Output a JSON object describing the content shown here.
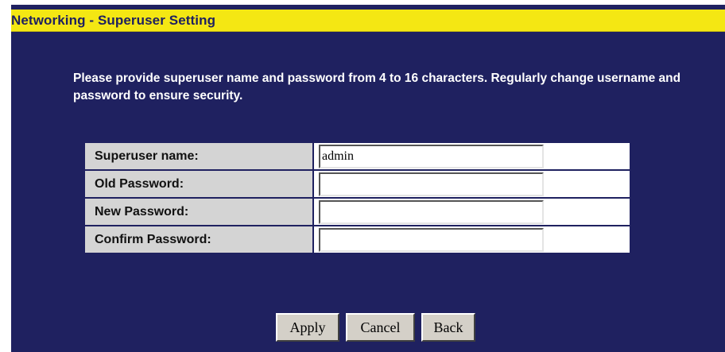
{
  "header": {
    "title": "Networking - Superuser Setting"
  },
  "description": "Please provide superuser name and password from 4 to 16 characters. Regularly change username and password to ensure security.",
  "form": {
    "fields": [
      {
        "label": "Superuser name:",
        "value": "admin",
        "type": "text"
      },
      {
        "label": "Old Password:",
        "value": "",
        "type": "password"
      },
      {
        "label": "New Password:",
        "value": "",
        "type": "password"
      },
      {
        "label": "Confirm Password:",
        "value": "",
        "type": "password"
      }
    ]
  },
  "buttons": {
    "apply": "Apply",
    "cancel": "Cancel",
    "back": "Back"
  },
  "colors": {
    "background": "#1f2160",
    "title_bar": "#f4e713",
    "label_cell": "#d4d4d4",
    "text_light": "#ffffff"
  }
}
